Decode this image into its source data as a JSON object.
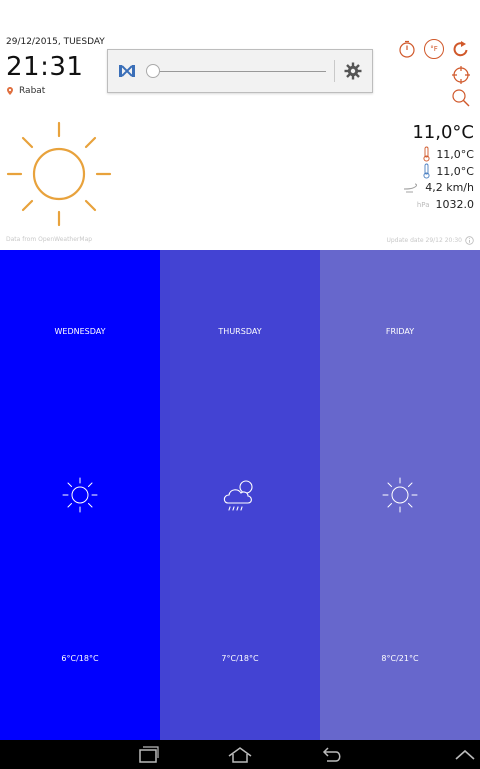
{
  "header": {
    "date": "29/12/2015, TUESDAY",
    "time": "21:31",
    "location": "Rabat"
  },
  "toolbar": {
    "icons": [
      "timer-icon",
      "fahrenheit-icon",
      "refresh-icon",
      "gps-icon",
      "search-icon"
    ],
    "fahrenheit_label": "°F"
  },
  "media_player": {
    "icons": [
      "media-app-icon",
      "settings-icon"
    ],
    "progress": 0
  },
  "current": {
    "temperature": "11,0°C",
    "temp_max": "11,0°C",
    "temp_min": "11,0°C",
    "wind": "4,2 km/h",
    "pressure_unit": "hPa",
    "pressure": "1032.0",
    "source_note": "Data from OpenWeatherMap",
    "update_note": "Update date 29/12 20:30"
  },
  "forecast": [
    {
      "day": "WEDNESDAY",
      "range": "6°C/18°C",
      "icon": "sun-icon",
      "color": "#0000ff"
    },
    {
      "day": "THURSDAY",
      "range": "7°C/18°C",
      "icon": "cloud-rain-icon",
      "color": "#4343d3"
    },
    {
      "day": "FRIDAY",
      "range": "8°C/21°C",
      "icon": "sun-icon",
      "color": "#6767cc"
    }
  ],
  "colors": {
    "accent": "#e8a23c",
    "toolbar_icon": "#d0582a"
  },
  "navbar": {
    "icons": [
      "recent-apps-icon",
      "home-icon",
      "back-icon",
      "up-icon"
    ]
  }
}
